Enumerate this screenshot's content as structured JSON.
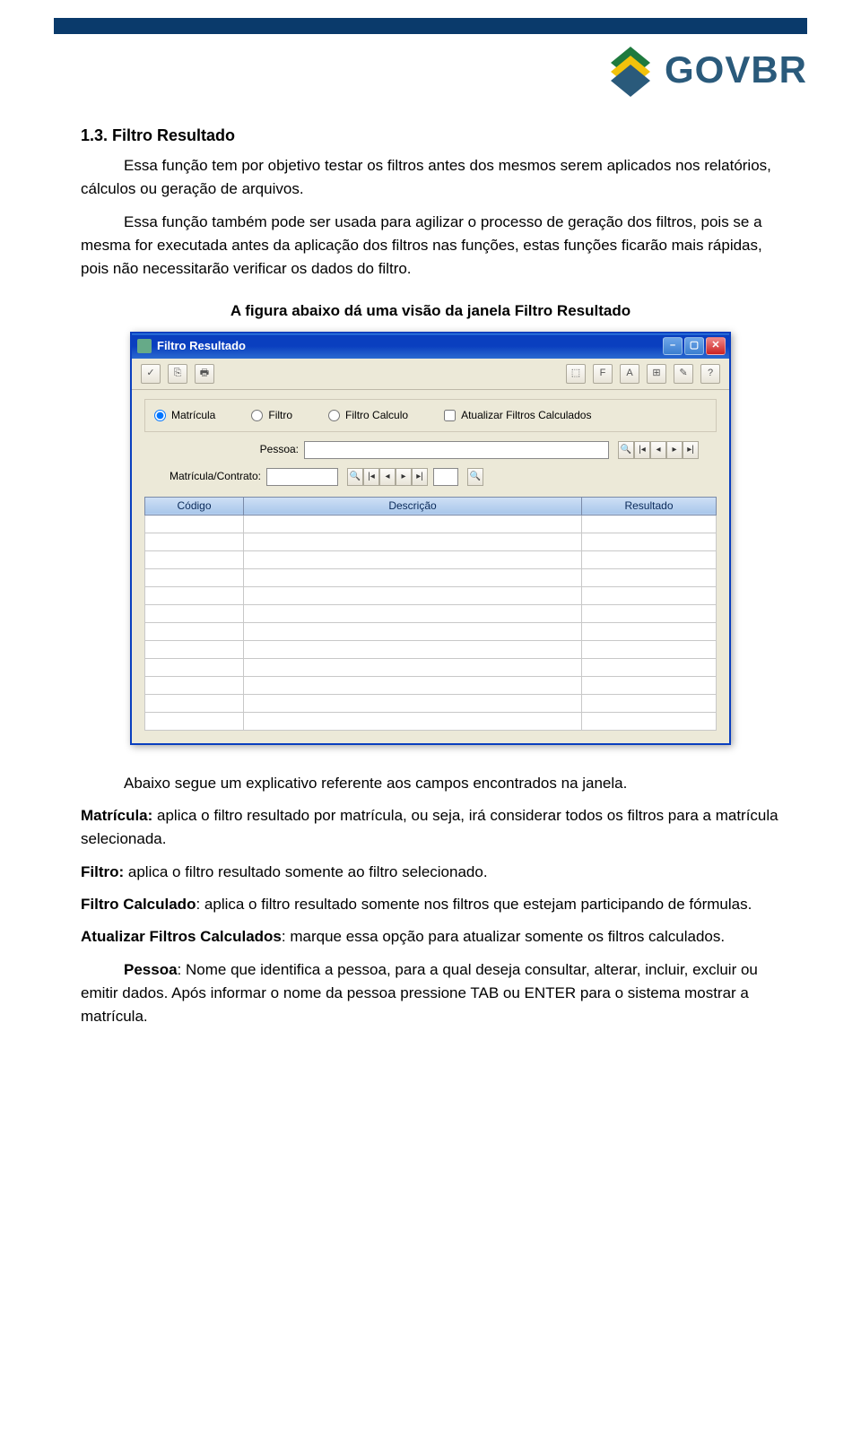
{
  "header": {
    "logo_text": "GOVBR"
  },
  "doc": {
    "heading": "1.3. Filtro Resultado",
    "p1": "Essa função tem por objetivo testar os filtros antes dos mesmos serem aplicados nos relatórios, cálculos ou geração de arquivos.",
    "p2": "Essa função também pode ser usada para agilizar o processo de geração dos filtros, pois se a mesma for executada antes da aplicação dos filtros nas funções, estas funções ficarão mais rápidas, pois não necessitarão verificar os dados do filtro.",
    "caption": "A figura abaixo dá uma visão da janela Filtro Resultado",
    "below_intro": "Abaixo segue um explicativo referente aos campos encontrados na janela.",
    "matricula_label": "Matrícula:",
    "matricula_text": " aplica o filtro resultado por matrícula, ou seja, irá considerar todos os filtros para a matrícula selecionada.",
    "filtro_label": "Filtro:",
    "filtro_text": " aplica o filtro resultado somente ao filtro selecionado.",
    "filtrocalc_label": "Filtro Calculado",
    "filtrocalc_text": ": aplica o filtro resultado somente nos filtros que estejam participando de fórmulas.",
    "atualizar_label": "Atualizar Filtros Calculados",
    "atualizar_text": ": marque essa opção para atualizar somente os filtros calculados.",
    "pessoa_label": "Pessoa",
    "pessoa_text": ": Nome que identifica a pessoa, para a qual deseja consultar, alterar, incluir, excluir ou emitir dados. Após informar o nome da pessoa pressione TAB ou ENTER para o sistema mostrar a matrícula."
  },
  "win": {
    "title": "Filtro Resultado",
    "radios": {
      "matricula": "Matrícula",
      "filtro": "Filtro",
      "filtro_calculo": "Filtro Calculo",
      "atualizar": "Atualizar Filtros Calculados"
    },
    "fields": {
      "pessoa_label": "Pessoa:",
      "matricula_label": "Matrícula/Contrato:"
    },
    "grid_headers": {
      "codigo": "Código",
      "descricao": "Descrição",
      "resultado": "Resultado"
    }
  }
}
